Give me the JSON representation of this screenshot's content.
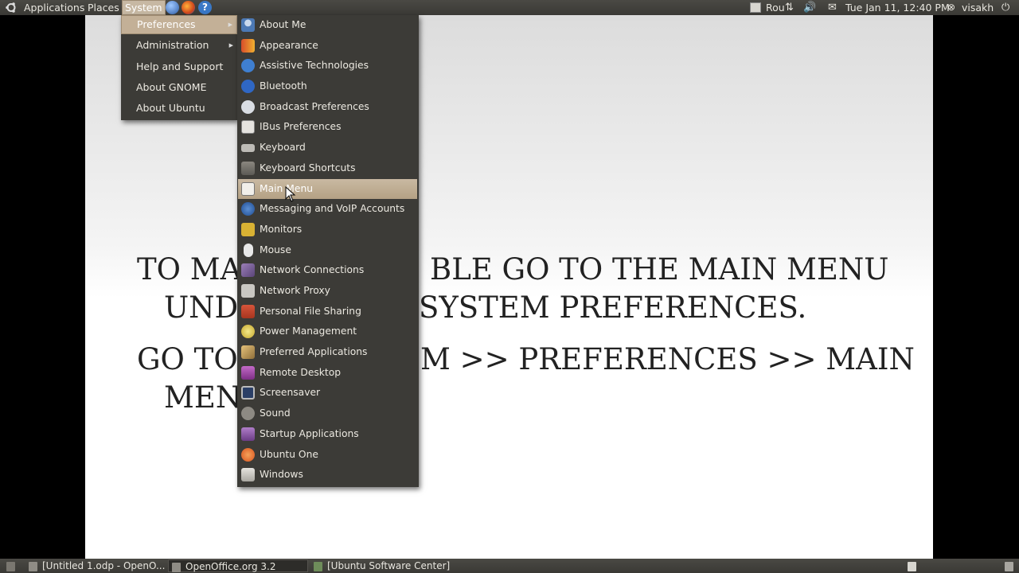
{
  "top_panel": {
    "menus": [
      "Applications",
      "Places",
      "System"
    ],
    "keyboard_layout": "Rou",
    "clock": "Tue Jan 11, 12:40 PM",
    "user": "visakh"
  },
  "slide": {
    "line1": "TO MA",
    "line1b": "BLE GO TO THE MAIN MENU",
    "line2": "UND",
    "line2b": "SYSTEM PREFERENCES.",
    "line3": "GO TO",
    "line3b": "M >> PREFERENCES >> MAIN",
    "line4": "MEN"
  },
  "system_menu": {
    "items": [
      "Preferences",
      "Administration",
      "Help and Support",
      "About GNOME",
      "About Ubuntu"
    ]
  },
  "preferences_menu": {
    "items": [
      {
        "label": "About Me",
        "icon": "user-icon"
      },
      {
        "label": "Appearance",
        "icon": "appearance-icon"
      },
      {
        "label": "Assistive Technologies",
        "icon": "accessibility-icon"
      },
      {
        "label": "Bluetooth",
        "icon": "bluetooth-icon"
      },
      {
        "label": "Broadcast Preferences",
        "icon": "broadcast-icon"
      },
      {
        "label": "IBus Preferences",
        "icon": "ibus-icon"
      },
      {
        "label": "Keyboard",
        "icon": "keyboard-icon"
      },
      {
        "label": "Keyboard Shortcuts",
        "icon": "keyboard-shortcuts-icon"
      },
      {
        "label": "Main Menu",
        "icon": "main-menu-icon"
      },
      {
        "label": "Messaging and VoIP Accounts",
        "icon": "messaging-icon"
      },
      {
        "label": "Monitors",
        "icon": "monitor-icon"
      },
      {
        "label": "Mouse",
        "icon": "mouse-icon"
      },
      {
        "label": "Network Connections",
        "icon": "network-icon"
      },
      {
        "label": "Network Proxy",
        "icon": "proxy-icon"
      },
      {
        "label": "Personal File Sharing",
        "icon": "file-sharing-icon"
      },
      {
        "label": "Power Management",
        "icon": "power-icon"
      },
      {
        "label": "Preferred Applications",
        "icon": "preferred-apps-icon"
      },
      {
        "label": "Remote Desktop",
        "icon": "remote-desktop-icon"
      },
      {
        "label": "Screensaver",
        "icon": "screensaver-icon"
      },
      {
        "label": "Sound",
        "icon": "sound-icon"
      },
      {
        "label": "Startup Applications",
        "icon": "startup-icon"
      },
      {
        "label": "Ubuntu One",
        "icon": "ubuntu-one-icon"
      },
      {
        "label": "Windows",
        "icon": "windows-icon"
      }
    ]
  },
  "taskbar": {
    "tasks": [
      "[Untitled 1.odp - OpenO...",
      "OpenOffice.org 3.2",
      "[Ubuntu Software Center]"
    ]
  }
}
